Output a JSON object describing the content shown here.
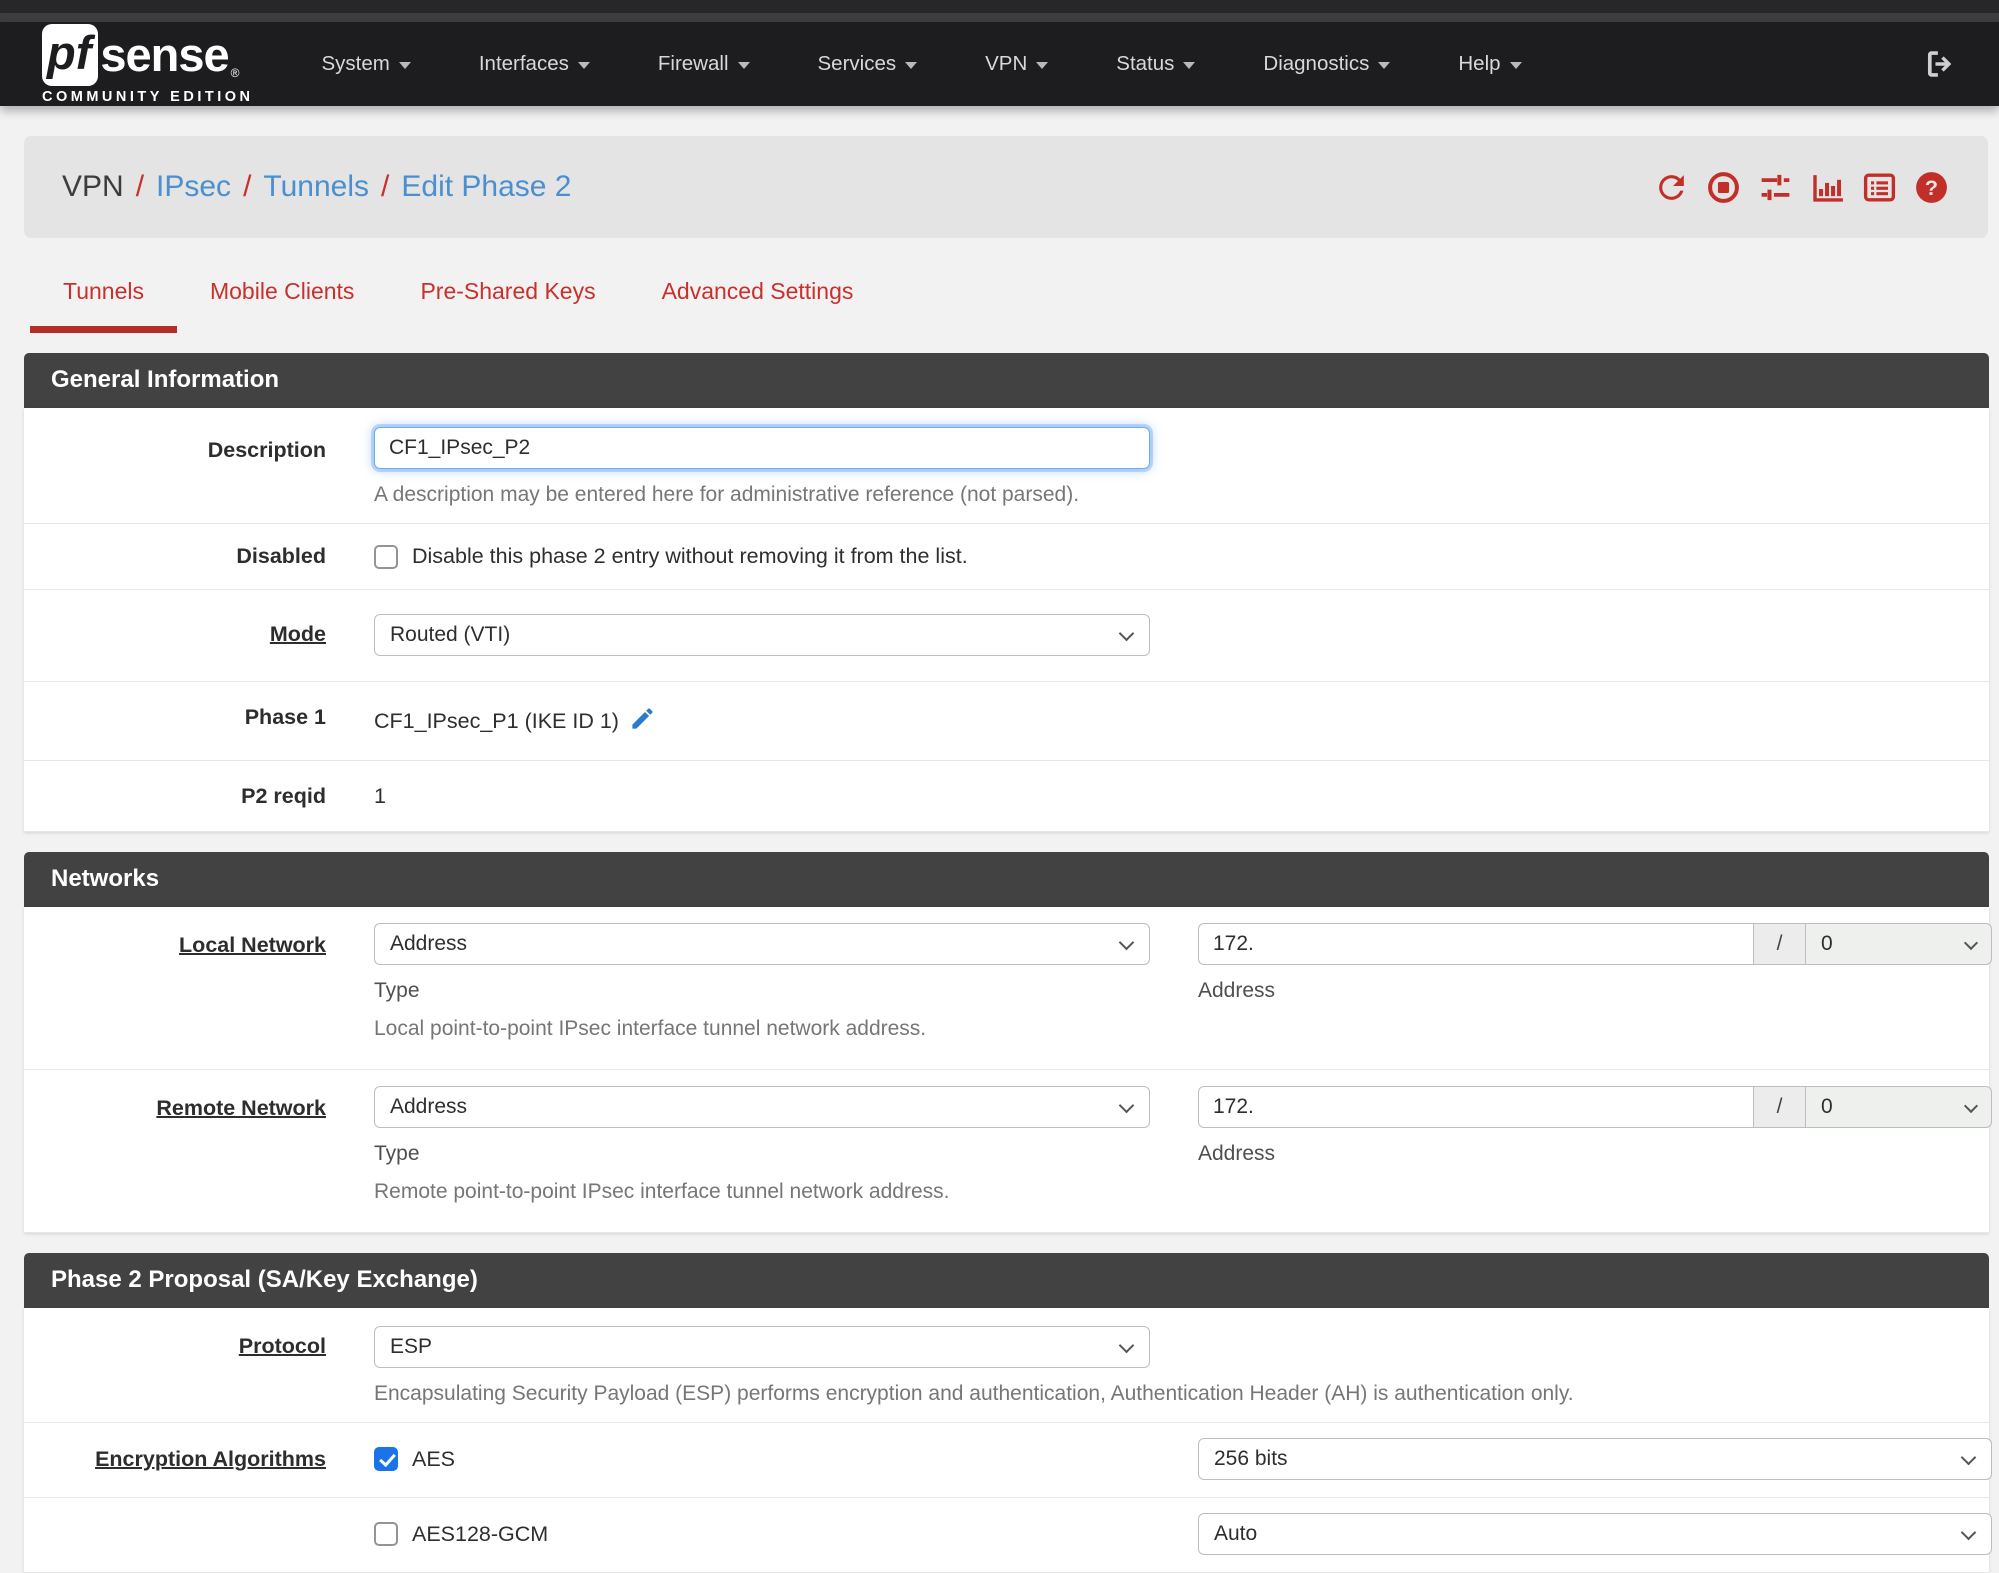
{
  "brand": {
    "pf": "pf",
    "sense": "sense",
    "registered": "®",
    "edition": "COMMUNITY EDITION"
  },
  "navbar": {
    "items": [
      {
        "label": "System"
      },
      {
        "label": "Interfaces"
      },
      {
        "label": "Firewall"
      },
      {
        "label": "Services"
      },
      {
        "label": "VPN"
      },
      {
        "label": "Status"
      },
      {
        "label": "Diagnostics"
      },
      {
        "label": "Help"
      }
    ]
  },
  "breadcrumb": {
    "separator": "/",
    "items": [
      {
        "label": "VPN"
      },
      {
        "label": "IPsec"
      },
      {
        "label": "Tunnels"
      },
      {
        "label": "Edit Phase 2"
      }
    ],
    "icons": [
      "refresh-icon",
      "stop-circle-icon",
      "sliders-icon",
      "bar-chart-icon",
      "list-icon",
      "help-icon"
    ]
  },
  "tabs": [
    {
      "label": "Tunnels",
      "active": true
    },
    {
      "label": "Mobile Clients",
      "active": false
    },
    {
      "label": "Pre-Shared Keys",
      "active": false
    },
    {
      "label": "Advanced Settings",
      "active": false
    }
  ],
  "general": {
    "title": "General Information",
    "description": {
      "label": "Description",
      "value": "CF1_IPsec_P2",
      "help": "A description may be entered here for administrative reference (not parsed)."
    },
    "disabled": {
      "label": "Disabled",
      "checked": false,
      "text": "Disable this phase 2 entry without removing it from the list."
    },
    "mode": {
      "label": "Mode",
      "value": "Routed (VTI)"
    },
    "phase1": {
      "label": "Phase 1",
      "value": "CF1_IPsec_P1 (IKE ID 1)"
    },
    "reqid": {
      "label": "P2 reqid",
      "value": "1"
    }
  },
  "networks": {
    "title": "Networks",
    "local": {
      "label": "Local Network",
      "type_value": "Address",
      "type_caption": "Type",
      "help": "Local point-to-point IPsec interface tunnel network address.",
      "address_value": "172.",
      "address_caption": "Address",
      "slash": "/",
      "mask_value": "0"
    },
    "remote": {
      "label": "Remote Network",
      "type_value": "Address",
      "type_caption": "Type",
      "help": "Remote point-to-point IPsec interface tunnel network address.",
      "address_value": "172.",
      "address_caption": "Address",
      "slash": "/",
      "mask_value": "0"
    }
  },
  "proposal": {
    "title": "Phase 2 Proposal (SA/Key Exchange)",
    "protocol": {
      "label": "Protocol",
      "value": "ESP",
      "help": "Encapsulating Security Payload (ESP) performs encryption and authentication, Authentication Header (AH) is authentication only."
    },
    "encryption": {
      "label": "Encryption Algorithms",
      "algorithms": [
        {
          "name": "AES",
          "checked": true,
          "bits": "256 bits"
        },
        {
          "name": "AES128-GCM",
          "checked": false,
          "bits": "Auto"
        }
      ]
    }
  },
  "colors": {
    "accent_red": "#c9302c",
    "link_blue": "#4a8fd0",
    "check_blue": "#1a73e8",
    "header_gray": "#424242"
  }
}
